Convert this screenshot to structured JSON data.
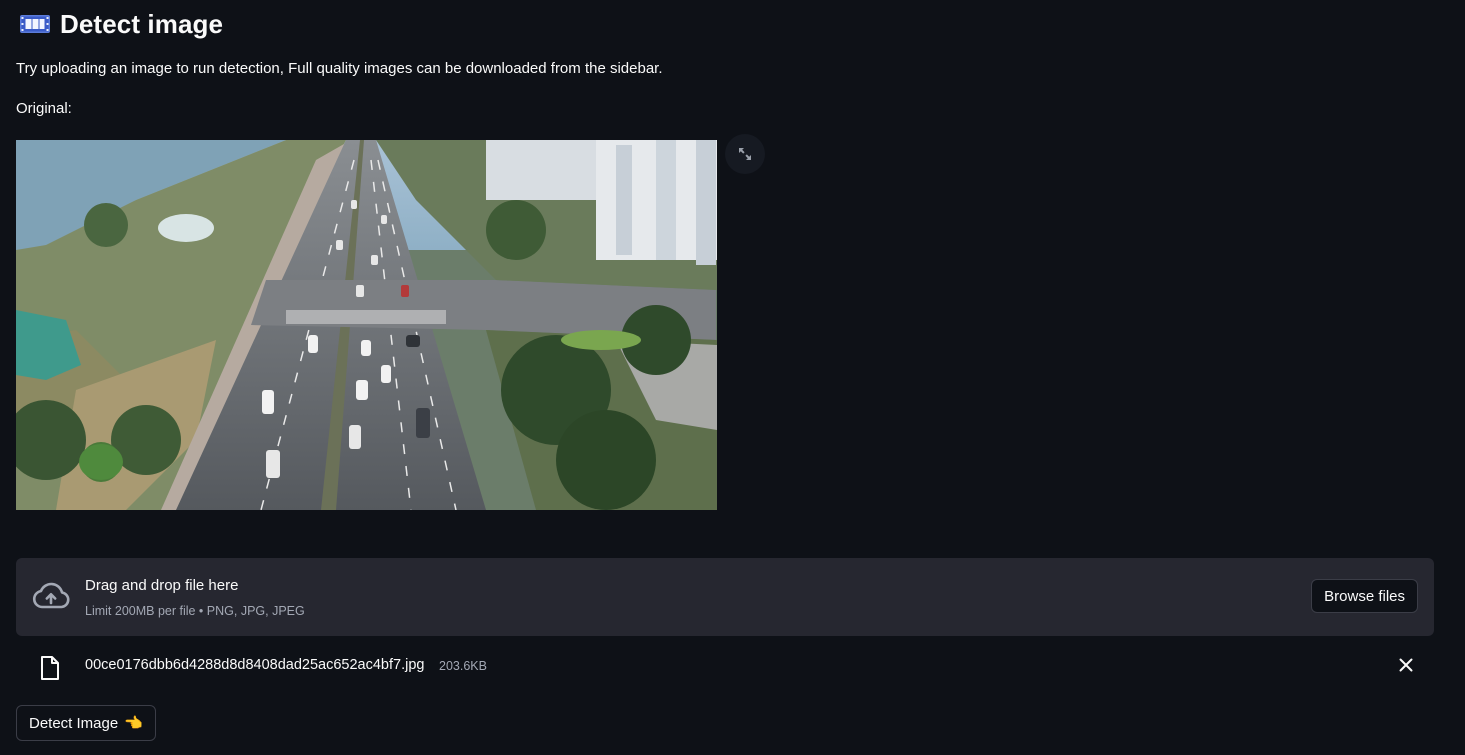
{
  "header": {
    "icon": "film-frames-icon",
    "title": "Detect image"
  },
  "intro_text": "Try uploading an image to run detection, Full quality images can be downloaded from the sidebar.",
  "original_label": "Original:",
  "image": {
    "subject": "aerial view of multi-lane road with cars, trees and high-rise buildings"
  },
  "expand_icon": "fullscreen-expand-icon",
  "uploader": {
    "icon": "cloud-upload-icon",
    "title": "Drag and drop file here",
    "limit": "Limit 200MB per file • PNG, JPG, JPEG",
    "browse_label": "Browse files"
  },
  "uploaded_file": {
    "icon": "file-icon",
    "name": "00ce0176dbb6d4288d8d8408dad25ac652ac4bf7.jpg",
    "size": "203.6KB",
    "remove_icon": "close-icon"
  },
  "detect_button": {
    "label": "Detect Image",
    "emoji": "👈"
  },
  "colors": {
    "background": "#0e1117",
    "panel": "#262730",
    "text": "#fafafa",
    "muted_text": "#a3a8b4",
    "button_border": "#3b3d47"
  }
}
